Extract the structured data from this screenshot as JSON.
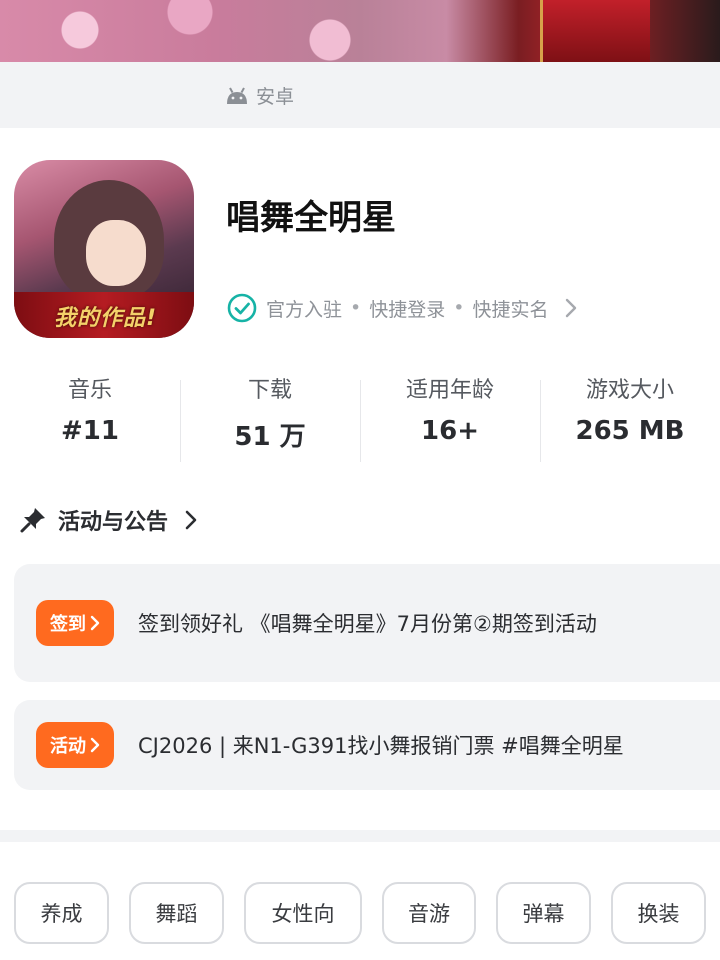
{
  "platform": {
    "label": "安卓",
    "icon": "android-icon"
  },
  "app": {
    "title": "唱舞全明星",
    "icon_logo_text": "我的作品!",
    "badges": [
      "官方入驻",
      "快捷登录",
      "快捷实名"
    ],
    "badge_separator": "•"
  },
  "stats": [
    {
      "label": "音乐",
      "value": "#11"
    },
    {
      "label": "下载",
      "value": "51 万"
    },
    {
      "label": "适用年龄",
      "value": "16+"
    },
    {
      "label": "游戏大小",
      "value": "265 MB"
    }
  ],
  "announcements": {
    "title": "活动与公告",
    "items": [
      {
        "tag": "签到",
        "text": "签到领好礼 《唱舞全明星》7月份第②期签到活动"
      },
      {
        "tag": "活动",
        "text": "CJ2026 | 来N1-G391找小舞报销门票 #唱舞全明星"
      }
    ]
  },
  "tags": [
    "养成",
    "舞蹈",
    "女性向",
    "音游",
    "弹幕",
    "换装"
  ],
  "colors": {
    "accent": "#ff6a1f",
    "verified": "#16b3a6",
    "surface": "#f2f3f5"
  }
}
